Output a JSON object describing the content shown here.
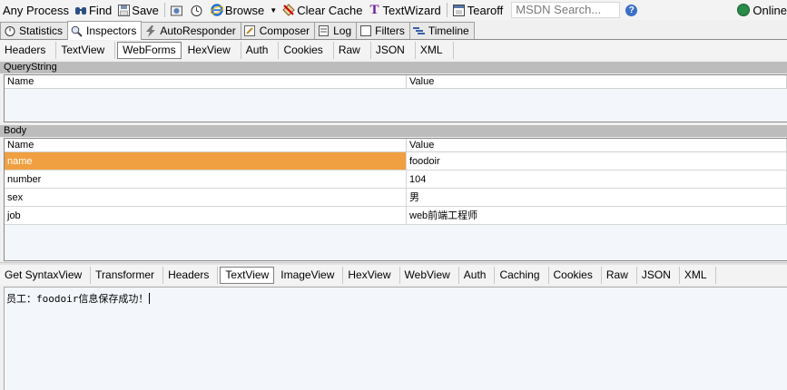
{
  "toolbar": {
    "any_process": "Any Process",
    "find": "Find",
    "save": "Save",
    "browse": "Browse",
    "clear_cache": "Clear Cache",
    "textwizard": "TextWizard",
    "tearoff": "Tearoff",
    "msdn_placeholder": "MSDN Search...",
    "online": "Online"
  },
  "main_tabs": [
    {
      "label": "Statistics",
      "icon": "stopwatch-icon"
    },
    {
      "label": "Inspectors",
      "icon": "magnifier-icon"
    },
    {
      "label": "AutoResponder",
      "icon": "lightning-icon"
    },
    {
      "label": "Composer",
      "icon": "pencil-icon"
    },
    {
      "label": "Log",
      "icon": "log-icon"
    },
    {
      "label": "Filters",
      "icon": "checkbox-icon"
    },
    {
      "label": "Timeline",
      "icon": "timeline-icon"
    }
  ],
  "active_main_tab": "Inspectors",
  "request_tabs": [
    "Headers",
    "TextView",
    "WebForms",
    "HexView",
    "Auth",
    "Cookies",
    "Raw",
    "JSON",
    "XML"
  ],
  "active_request_tab": "WebForms",
  "querystring": {
    "title": "QueryString",
    "col_name": "Name",
    "col_value": "Value"
  },
  "body": {
    "title": "Body",
    "col_name": "Name",
    "col_value": "Value",
    "rows": [
      {
        "name": "name",
        "value": "foodoir"
      },
      {
        "name": "number",
        "value": "104"
      },
      {
        "name": "sex",
        "value": "男"
      },
      {
        "name": "job",
        "value": "web前端工程师"
      }
    ]
  },
  "response_tabs": [
    "Get SyntaxView",
    "Transformer",
    "Headers",
    "TextView",
    "ImageView",
    "HexView",
    "WebView",
    "Auth",
    "Caching",
    "Cookies",
    "Raw",
    "JSON",
    "XML"
  ],
  "active_response_tab": "TextView",
  "response_text": "员工：foodoir信息保存成功！",
  "colors": {
    "selected_row": "#f0a040",
    "section_header": "#bcbcbc"
  }
}
